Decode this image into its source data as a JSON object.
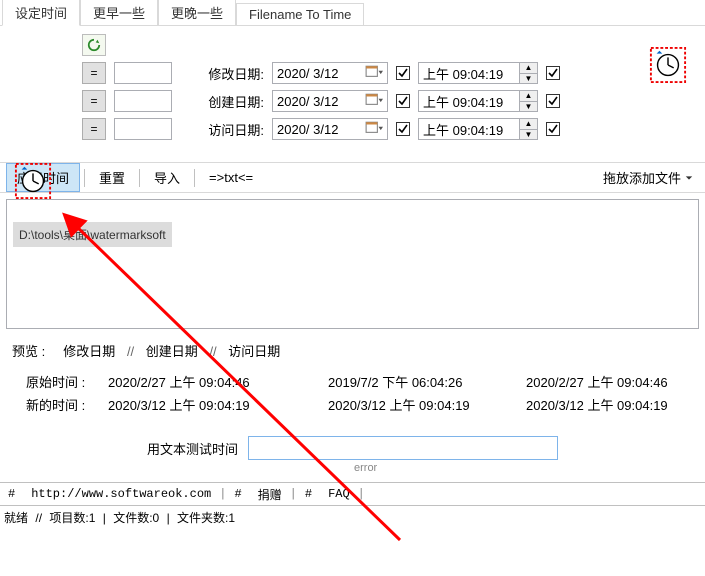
{
  "tabs": {
    "set_time": "设定时间",
    "earlier": "更早一些",
    "later": "更晚一些",
    "fname_to_time": "Filename To Time"
  },
  "rows": {
    "modify": {
      "label": "修改日期:",
      "date": "2020/ 3/12",
      "time": "上午 09:04:19"
    },
    "create": {
      "label": "创建日期:",
      "date": "2020/ 3/12",
      "time": "上午 09:04:19"
    },
    "access": {
      "label": "访问日期:",
      "date": "2020/ 3/12",
      "time": "上午 09:04:19"
    }
  },
  "eq": "=",
  "toolbar": {
    "apply": "应用时间",
    "reset": "重置",
    "import": "导入",
    "totxt": "=>txt<=",
    "dragadd": "拖放添加文件"
  },
  "file_item": "D:\\tools\\桌面\\watermarksoft",
  "preview": {
    "head_label": "预览 :",
    "cols": {
      "modify": "修改日期",
      "create": "创建日期",
      "access": "访问日期"
    },
    "sep": "//",
    "orig_label": "原始时间 :",
    "new_label": "新的时间 :",
    "orig": {
      "c1": "2020/2/27 上午 09:04:46",
      "c2": "2019/7/2 下午 06:04:26",
      "c3": "2020/2/27 上午 09:04:46"
    },
    "newt": {
      "c1": "2020/3/12 上午 09:04:19",
      "c2": "2020/3/12 上午 09:04:19",
      "c3": "2020/3/12 上午 09:04:19"
    }
  },
  "test": {
    "label": "用文本测试时间",
    "value": "",
    "error": "error"
  },
  "linkbar": {
    "hash": "#",
    "url": "http://www.softwareok.com",
    "donate": "捐赠",
    "faq": "FAQ",
    "sep": "|"
  },
  "status": {
    "ready": "就绪",
    "sep": "//",
    "items": "项目数:1",
    "files": "文件数:0",
    "folders": "文件夹数:1"
  }
}
